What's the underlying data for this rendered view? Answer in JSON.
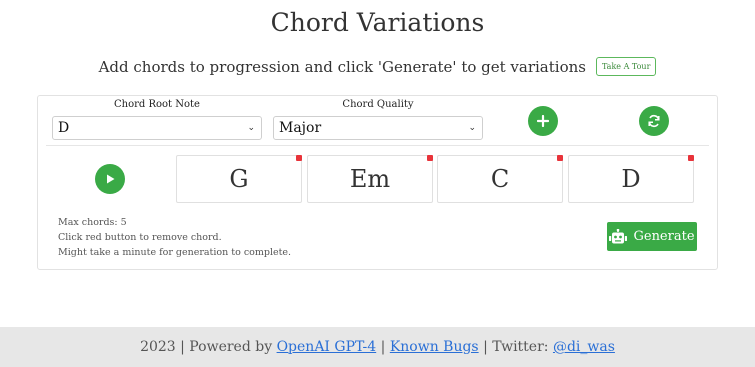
{
  "header": {
    "title": "Chord Variations",
    "subtitle": "Add chords to progression and click 'Generate' to get variations",
    "tour_label": "Take A Tour"
  },
  "controls": {
    "root_label": "Chord Root Note",
    "root_value": "D",
    "quality_label": "Chord Quality",
    "quality_value": "Major",
    "add_icon": "plus-icon",
    "refresh_icon": "refresh-icon",
    "play_icon": "play-icon"
  },
  "chords": [
    "G",
    "Em",
    "C",
    "D"
  ],
  "notes": {
    "line1": "Max chords: 5",
    "line2": "Click red button to remove chord.",
    "line3": "Might take a minute for generation to complete."
  },
  "generate": {
    "label": "Generate",
    "icon": "robot-icon"
  },
  "footer": {
    "prefix": "2023 | Powered by ",
    "link1": "OpenAI GPT-4",
    "sep1": " | ",
    "link2": "Known Bugs",
    "sep2": " | Twitter: ",
    "link3": "@di_was"
  },
  "colors": {
    "accent": "#3aaa46",
    "remove": "#e8333a",
    "link": "#2a6fd6",
    "footer_bg": "#e7e7e7"
  }
}
